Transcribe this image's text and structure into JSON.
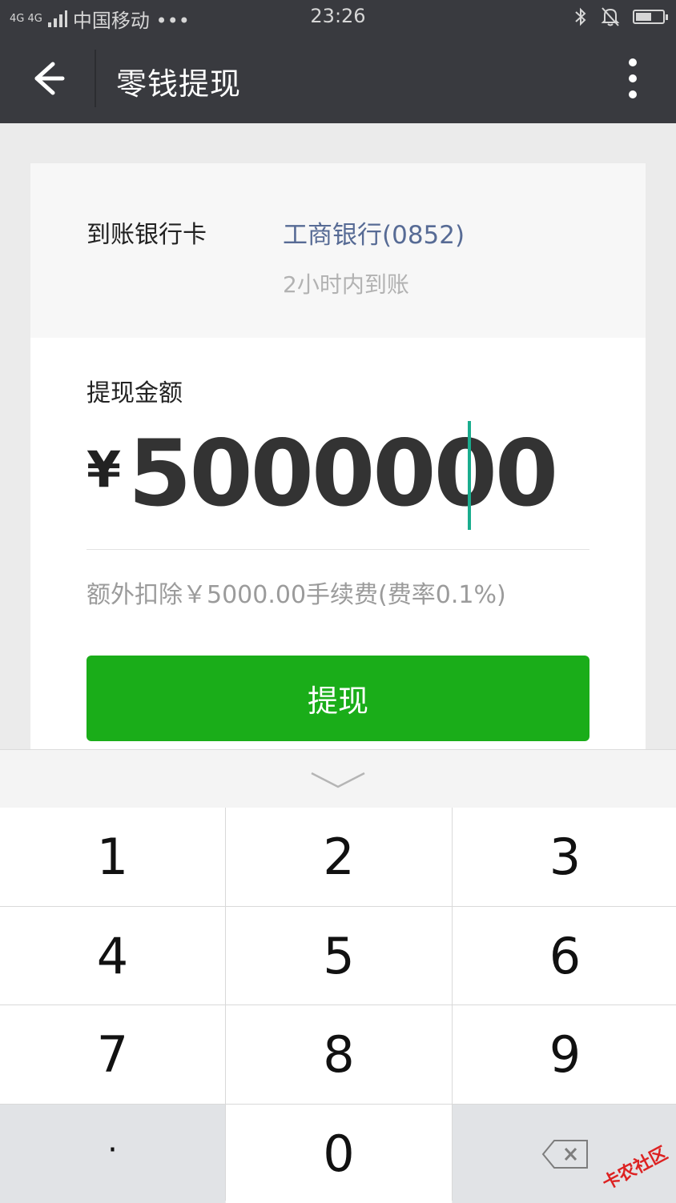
{
  "status_bar": {
    "network": "4G 4G",
    "carrier": "中国移动 •••",
    "time": "23:26",
    "battery_level": 0.6
  },
  "nav": {
    "title": "零钱提现"
  },
  "bank": {
    "label": "到账银行卡",
    "name": "工商银行(0852)",
    "arrival": "2小时内到账"
  },
  "withdraw": {
    "label": "提现金额",
    "currency": "¥",
    "amount": "5000000",
    "fee_note": "额外扣除￥5000.00手续费(费率0.1%)",
    "button": "提现"
  },
  "keypad": {
    "k1": "1",
    "k2": "2",
    "k3": "3",
    "k4": "4",
    "k5": "5",
    "k6": "6",
    "k7": "7",
    "k8": "8",
    "k9": "9",
    "kdot": "·",
    "k0": "0"
  },
  "watermark": "卡农社区",
  "colors": {
    "nav_bg": "#393a3f",
    "link": "#576b95",
    "primary_button": "#1aad19",
    "cursor": "#1aad8e"
  }
}
